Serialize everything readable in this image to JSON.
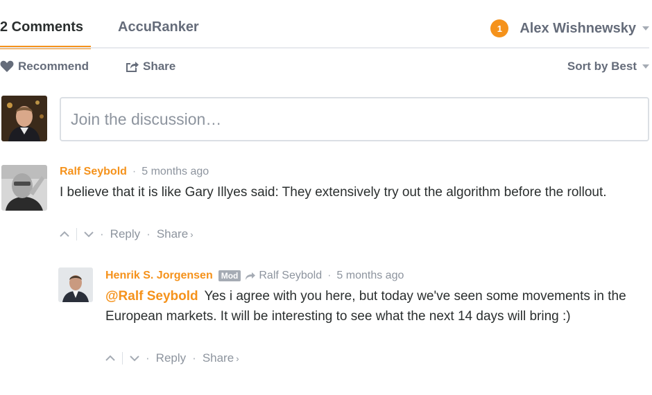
{
  "nav": {
    "comments_tab": "2 Comments",
    "forum_tab": "AccuRanker",
    "notification_count": "1",
    "user_name": "Alex Wishnewsky"
  },
  "toolbar": {
    "recommend": "Recommend",
    "share": "Share",
    "sort": "Sort by Best"
  },
  "composer": {
    "placeholder": "Join the discussion…"
  },
  "posts": [
    {
      "author": "Ralf Seybold",
      "time": "5 months ago",
      "body": "I believe that it is like Gary Illyes said: They extensively try out the algorithm before the rollout.",
      "reply": "Reply",
      "share": "Share"
    },
    {
      "author": "Henrik S. Jorgensen",
      "badge": "Mod",
      "reply_to": "Ralf Seybold",
      "time": "5 months ago",
      "mention": "@Ralf Seybold",
      "body": "Yes i agree with you here, but today we've seen some movements in the European markets. It will be interesting to see what the next 14 days will bring :)",
      "reply": "Reply",
      "share": "Share"
    }
  ],
  "colors": {
    "accent": "#f5921b",
    "muted": "#656c7a",
    "light": "#8d949e",
    "text": "#2a2e2e",
    "border": "#dbdfe4"
  },
  "icons": {
    "recommend": "heart-icon",
    "share": "share-arrow-icon",
    "upvote": "chevron-up-icon",
    "downvote": "chevron-down-icon",
    "reply_to": "reply-arrow-icon"
  }
}
